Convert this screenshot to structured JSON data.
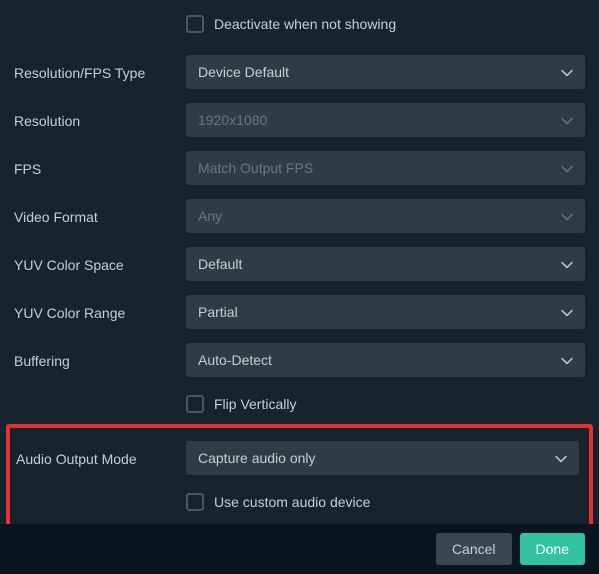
{
  "checkboxes": {
    "deactivate_label": "Deactivate when not showing",
    "flip_label": "Flip Vertically",
    "custom_audio_label": "Use custom audio device"
  },
  "labels": {
    "resolution_fps_type": "Resolution/FPS Type",
    "resolution": "Resolution",
    "fps": "FPS",
    "video_format": "Video Format",
    "yuv_color_space": "YUV Color Space",
    "yuv_color_range": "YUV Color Range",
    "buffering": "Buffering",
    "audio_output_mode": "Audio Output Mode"
  },
  "selects": {
    "resolution_fps_type": "Device Default",
    "resolution": "1920x1080",
    "fps": "Match Output FPS",
    "video_format": "Any",
    "yuv_color_space": "Default",
    "yuv_color_range": "Partial",
    "buffering": "Auto-Detect",
    "audio_output_mode": "Capture audio only"
  },
  "footer": {
    "cancel_label": "Cancel",
    "done_label": "Done"
  },
  "colors": {
    "highlight_border": "#e63030",
    "primary_button": "#31c3a2"
  }
}
